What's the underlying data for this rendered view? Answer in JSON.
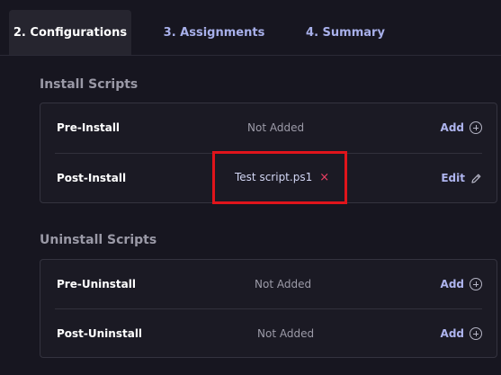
{
  "tabs": [
    {
      "label": "2. Configurations",
      "active": true
    },
    {
      "label": "3. Assignments",
      "active": false
    },
    {
      "label": "4. Summary",
      "active": false
    }
  ],
  "install_scripts": {
    "title": "Install Scripts",
    "rows": [
      {
        "label": "Pre-Install",
        "status": "Not Added",
        "action": "Add",
        "action_icon": "circle-plus-icon"
      },
      {
        "label": "Post-Install",
        "script": "Test script.ps1",
        "remove_icon": "×",
        "action": "Edit",
        "action_icon": "pencil-icon"
      }
    ]
  },
  "uninstall_scripts": {
    "title": "Uninstall Scripts",
    "rows": [
      {
        "label": "Pre-Uninstall",
        "status": "Not Added",
        "action": "Add",
        "action_icon": "circle-plus-icon"
      },
      {
        "label": "Post-Uninstall",
        "status": "Not Added",
        "action": "Add",
        "action_icon": "circle-plus-icon"
      }
    ]
  },
  "colors": {
    "background": "#171620",
    "accent": "#aeb4ee",
    "highlight": "#e0141b",
    "remove": "#ef4064"
  }
}
